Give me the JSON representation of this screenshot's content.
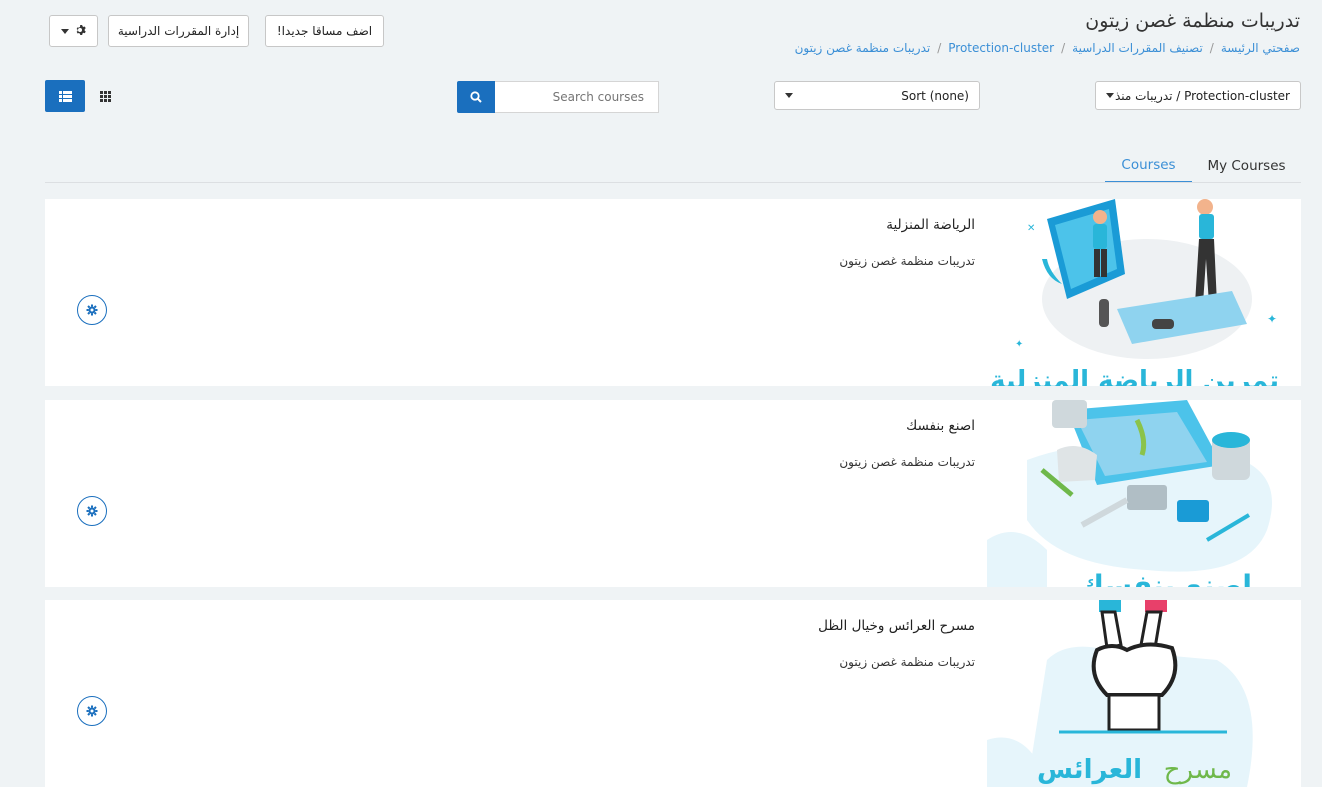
{
  "header": {
    "title": "تدريبات منظمة غصن زيتون",
    "breadcrumb": [
      "صفحتي الرئيسة",
      "تصنيف المقررات الدراسية",
      "Protection-cluster",
      "تدريبات منظمة غصن زيتون"
    ]
  },
  "actions": {
    "add_label": "اضف مساقا جديدا!",
    "manage_label": "إدارة المقررات الدراسية"
  },
  "filters": {
    "category_value": "Protection-cluster / تدريبات منذ",
    "sort_value": "Sort (none)",
    "search_placeholder": "Search courses"
  },
  "tabs": [
    {
      "label": "My Courses"
    },
    {
      "label": "Courses"
    }
  ],
  "courses": [
    {
      "title": "الرياضة المنزلية",
      "category": "تدريبات منظمة غصن زيتون",
      "image_text": "تمرين الرياضة المنزلية"
    },
    {
      "title": "اصنع بنفسك",
      "category": "تدريبات منظمة غصن زيتون",
      "image_text": "اصنع بنفسك"
    },
    {
      "title": "مسرح العرائس وخيال الظل",
      "category": "تدريبات منظمة غصن زيتون",
      "image_text_1": "مسرح",
      "image_text_2": "العرائس"
    }
  ],
  "colors": {
    "primary": "#1a6fbe",
    "link": "#3b8fd6",
    "accent_teal": "#29b6d9"
  }
}
